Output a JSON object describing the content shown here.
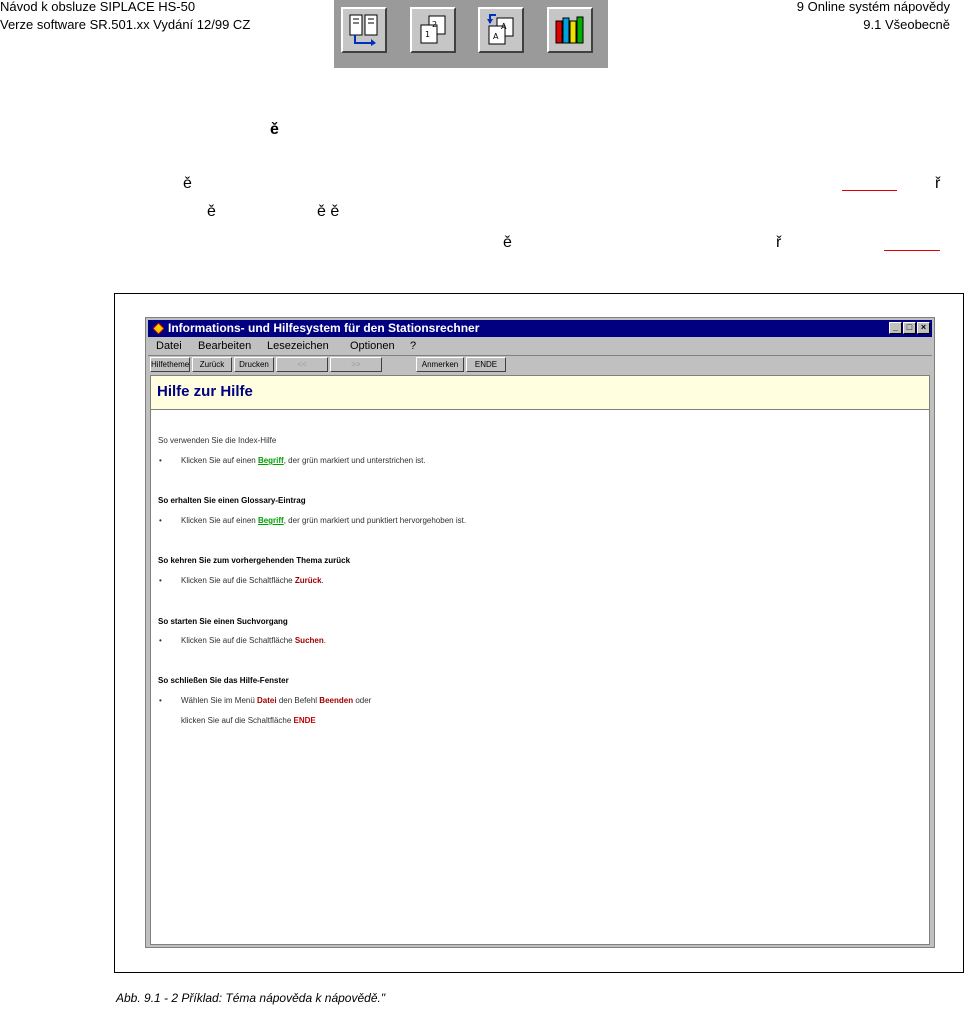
{
  "header": {
    "left_line1": "Návod k obsluze SIPLACE HS-50",
    "left_line2": "Verze software SR.501.xx    Vydání 12/99 CZ",
    "right_line1": "9 Online systém nápovědy",
    "right_line2": "9.1 Všeobecně"
  },
  "toolbar_icons": [
    "contents-icon",
    "pages-icon",
    "index-icon",
    "books-icon"
  ],
  "glyphs": {
    "g1": "ě",
    "g2": "ě",
    "g3": "ř",
    "g4": "ě",
    "g5": "ě ě",
    "g6": "ě",
    "g7": "ř"
  },
  "window": {
    "title": "Informations- und Hilfesystem für den Stationsrechner",
    "menu": [
      "Datei",
      "Bearbeiten",
      "Lesezeichen",
      "Optionen",
      "?"
    ],
    "buttons": [
      "Hilfethemen",
      "Zurück",
      "Drucken",
      "<<",
      ">>",
      "Anmerken",
      "ENDE"
    ],
    "heading": "Hilfe zur Hilfe",
    "sec1_title": "So verwenden Sie die Index-Hilfe",
    "sec1_pre": "Klicken Sie auf einen ",
    "sec1_link": "Begriff",
    "sec1_post": ", der grün markiert und unterstrichen ist.",
    "sec2_title": "So erhalten Sie einen Glossary-Eintrag",
    "sec2_pre": "Klicken Sie auf einen ",
    "sec2_link": "Begriff",
    "sec2_post": ", der grün markiert und punktiert hervorgehoben ist.",
    "sec3_title": "So kehren Sie zum vorhergehenden Thema zurück",
    "sec3_pre": "Klicken Sie auf die Schaltfläche ",
    "sec3_bold": "Zurück",
    "sec3_post": ".",
    "sec4_title": "So starten Sie einen Suchvorgang",
    "sec4_pre": "Klicken Sie auf die Schaltfläche ",
    "sec4_bold": "Suchen",
    "sec4_post": ".",
    "sec5_title": "So schließen Sie das Hilfe-Fenster",
    "sec5_l1_pre": "Wählen Sie im Menü ",
    "sec5_l1_b1": "Datei",
    "sec5_l1_mid": " den Befehl ",
    "sec5_l1_b2": "Beenden",
    "sec5_l1_post": " oder",
    "sec5_l2_pre": "klicken Sie auf die Schaltfläche ",
    "sec5_l2_bold": "ENDE",
    "bullet": "•"
  },
  "caption": "Abb. 9.1 - 2       Příklad: Téma nápověda k nápovědě.\""
}
